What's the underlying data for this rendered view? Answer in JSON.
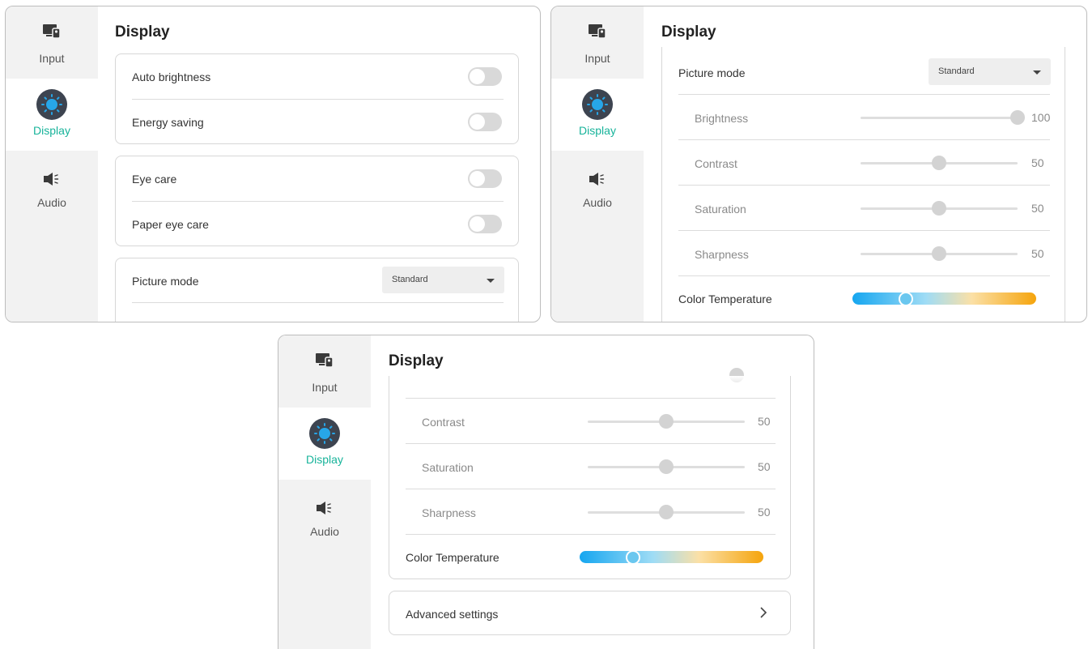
{
  "nav": {
    "items": [
      {
        "label": "Input",
        "icon": "input-source-icon"
      },
      {
        "label": "Display",
        "icon": "display-brightness-icon",
        "active": true
      },
      {
        "label": "Audio",
        "icon": "speaker-icon"
      }
    ]
  },
  "title": "Display",
  "panel1": {
    "auto_brightness": {
      "label": "Auto brightness",
      "on": false
    },
    "energy_saving": {
      "label": "Energy saving",
      "on": false
    },
    "eye_care": {
      "label": "Eye care",
      "on": false
    },
    "paper_eye_care": {
      "label": "Paper eye care",
      "on": false
    },
    "picture_mode": {
      "label": "Picture mode",
      "value": "Standard"
    }
  },
  "picture": {
    "picture_mode_label": "Picture mode",
    "picture_mode_value": "Standard",
    "brightness": {
      "label": "Brightness",
      "value": "100"
    },
    "contrast": {
      "label": "Contrast",
      "value": "50"
    },
    "saturation": {
      "label": "Saturation",
      "value": "50"
    },
    "sharpness": {
      "label": "Sharpness",
      "value": "50"
    },
    "color_temperature_label": "Color Temperature",
    "color_temperature_level": 0.3
  },
  "advanced_settings": {
    "label": "Advanced settings",
    "chevron": "chevron-right-icon"
  },
  "colors": {
    "accent": "#17b39a",
    "sidebar": "#f2f2f2",
    "knob": "#6ac7ef"
  }
}
